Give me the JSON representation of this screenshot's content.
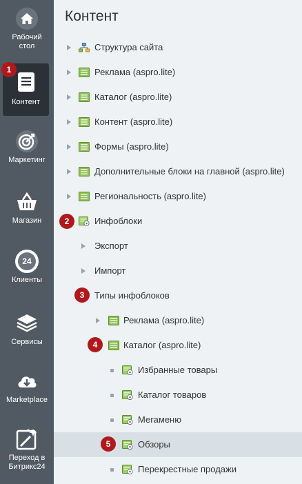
{
  "sidebar": {
    "items": [
      {
        "label1": "Рабочий",
        "label2": "стол"
      },
      {
        "label1": "Контент",
        "label2": ""
      },
      {
        "label1": "Маркетинг",
        "label2": ""
      },
      {
        "label1": "Магазин",
        "label2": ""
      },
      {
        "label1": "Клиенты",
        "label2": ""
      },
      {
        "label1": "Сервисы",
        "label2": ""
      },
      {
        "label1": "Marketplace",
        "label2": ""
      },
      {
        "label1": "Переход в",
        "label2": "Битрикс24"
      }
    ],
    "clients_icon_text": "24",
    "active": "Контент"
  },
  "main": {
    "title": "Контент",
    "tree": [
      {
        "label": "Структура сайта"
      },
      {
        "label": "Реклама (aspro.lite)"
      },
      {
        "label": "Каталог (aspro.lite)"
      },
      {
        "label": "Контент (aspro.lite)"
      },
      {
        "label": "Формы (aspro.lite)"
      },
      {
        "label": "Дополнительные блоки на главной (aspro.lite)"
      },
      {
        "label": "Региональность (aspro.lite)"
      },
      {
        "label": "Инфоблоки"
      },
      {
        "label": "Экспорт"
      },
      {
        "label": "Импорт"
      },
      {
        "label": "Типы инфоблоков"
      },
      {
        "label": "Реклама (aspro.lite)"
      },
      {
        "label": "Каталог (aspro.lite)"
      },
      {
        "label": "Избранные товары"
      },
      {
        "label": "Каталог товаров"
      },
      {
        "label": "Мегаменю"
      },
      {
        "label": "Обзоры"
      },
      {
        "label": "Перекрестные продажи"
      }
    ]
  },
  "badges": [
    "1",
    "2",
    "3",
    "4",
    "5"
  ],
  "colors": {
    "sidebar_bg": "#515a63",
    "sidebar_active_bg": "#2c3138",
    "main_bg": "#eef2f4",
    "selected_row_bg": "#d9e0e5",
    "badge_red": "#b0191c"
  }
}
